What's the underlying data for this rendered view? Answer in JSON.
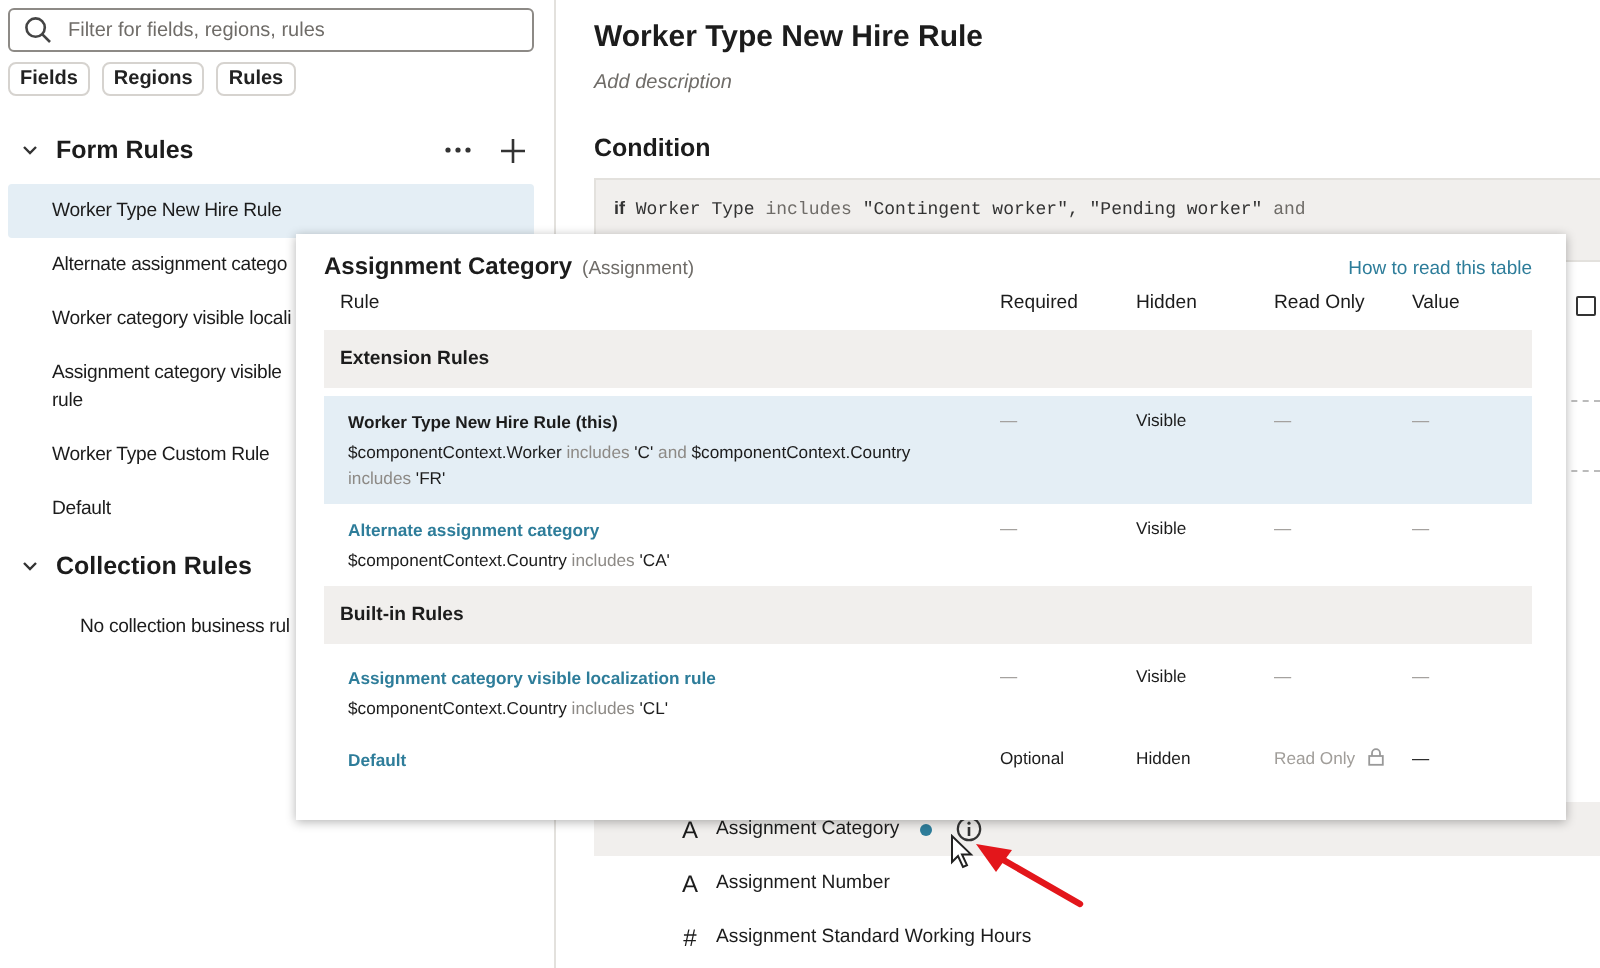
{
  "sidebar": {
    "search": {
      "placeholder": "Filter for fields, regions, rules"
    },
    "chips": [
      {
        "label": "Fields"
      },
      {
        "label": "Regions"
      },
      {
        "label": "Rules"
      }
    ],
    "sections": [
      {
        "title": "Form Rules",
        "expanded": true,
        "actions": true,
        "items": [
          {
            "label": "Worker Type New Hire Rule",
            "selected": true
          },
          {
            "label": "Alternate assignment catego",
            "selected": false
          },
          {
            "label": "Worker category visible locali",
            "selected": false
          },
          {
            "label": "Assignment category visible rule",
            "selected": false
          },
          {
            "label": "Worker Type Custom Rule",
            "selected": false
          },
          {
            "label": "Default",
            "selected": false
          }
        ]
      },
      {
        "title": "Collection Rules",
        "expanded": true,
        "actions": false,
        "empty": "No collection business rul"
      }
    ]
  },
  "main": {
    "title": "Worker Type New Hire Rule",
    "description_placeholder": "Add description",
    "condition_heading": "Condition",
    "condition_code": [
      {
        "kind": "keyword",
        "text": "if"
      },
      {
        "kind": "field",
        "text": "Worker Type"
      },
      {
        "kind": "op",
        "text": "includes"
      },
      {
        "kind": "string",
        "text": "\"Contingent worker\", \"Pending worker\""
      },
      {
        "kind": "op",
        "text": "and"
      }
    ],
    "checkbox": {
      "checked": false
    },
    "fields": [
      {
        "glyph": "A",
        "label": "Assignment Category",
        "selected": true,
        "has_rule": true,
        "info": true
      },
      {
        "glyph": "A",
        "label": "Assignment Number",
        "selected": false,
        "has_rule": false,
        "info": false
      },
      {
        "glyph": "#",
        "label": "Assignment Standard Working Hours",
        "selected": false,
        "has_rule": false,
        "info": false
      }
    ]
  },
  "popup": {
    "title": "Assignment Category",
    "subtitle": "(Assignment)",
    "help_link": "How to read this table",
    "columns": [
      "Rule",
      "Required",
      "Hidden",
      "Read Only",
      "Value"
    ],
    "groups": [
      {
        "title": "Extension Rules",
        "rows": [
          {
            "name": "Worker Type New Hire Rule (this)",
            "link": false,
            "selected": true,
            "condition": [
              {
                "kind": "field",
                "text": "$componentContext.Worker"
              },
              {
                "kind": "op",
                "text": "includes"
              },
              {
                "kind": "string",
                "text": "'C'"
              },
              {
                "kind": "op",
                "text": "and"
              },
              {
                "kind": "field",
                "text": "$componentContext.Country"
              },
              {
                "kind": "op",
                "text": "includes"
              },
              {
                "kind": "string",
                "text": "'FR'"
              }
            ],
            "cells": [
              {
                "text": "—",
                "muted": true
              },
              {
                "text": "Visible",
                "muted": false
              },
              {
                "text": "—",
                "muted": true,
                "locked": false
              },
              {
                "text": "—",
                "muted": true
              }
            ]
          },
          {
            "name": "Alternate assignment category",
            "link": true,
            "selected": false,
            "condition": [
              {
                "kind": "field",
                "text": "$componentContext.Country"
              },
              {
                "kind": "op",
                "text": "includes"
              },
              {
                "kind": "string",
                "text": "'CA'"
              }
            ],
            "cells": [
              {
                "text": "—",
                "muted": true
              },
              {
                "text": "Visible",
                "muted": false
              },
              {
                "text": "—",
                "muted": true,
                "locked": false
              },
              {
                "text": "—",
                "muted": true
              }
            ]
          }
        ]
      },
      {
        "title": "Built-in Rules",
        "rows": [
          {
            "name": "Assignment category visible localization rule",
            "link": true,
            "selected": false,
            "condition": [
              {
                "kind": "field",
                "text": "$componentContext.Country"
              },
              {
                "kind": "op",
                "text": "includes"
              },
              {
                "kind": "string",
                "text": "'CL'"
              }
            ],
            "cells": [
              {
                "text": "—",
                "muted": true
              },
              {
                "text": "Visible",
                "muted": false
              },
              {
                "text": "—",
                "muted": true,
                "locked": false
              },
              {
                "text": "—",
                "muted": true
              }
            ]
          },
          {
            "name": "Default",
            "link": true,
            "selected": false,
            "cells": [
              {
                "text": "Optional",
                "muted": false
              },
              {
                "text": "Hidden",
                "muted": false
              },
              {
                "text": "Read Only",
                "muted": true,
                "locked": true
              },
              {
                "text": "—",
                "muted": false
              }
            ]
          }
        ]
      }
    ]
  }
}
